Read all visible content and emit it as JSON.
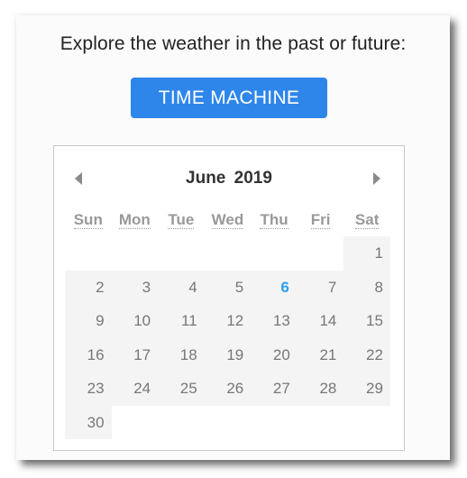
{
  "headline": "Explore the weather in the past or future:",
  "time_machine_button": "TIME MACHINE",
  "calendar": {
    "month": "June",
    "year": "2019",
    "prev_icon": "triangle-left",
    "next_icon": "triangle-right",
    "weekdays": [
      "Sun",
      "Mon",
      "Tue",
      "Wed",
      "Thu",
      "Fri",
      "Sat"
    ],
    "today": "6",
    "accent_color": "#2d9ef0",
    "weeks": [
      [
        "",
        "",
        "",
        "",
        "",
        "",
        "1"
      ],
      [
        "2",
        "3",
        "4",
        "5",
        "6",
        "7",
        "8"
      ],
      [
        "9",
        "10",
        "11",
        "12",
        "13",
        "14",
        "15"
      ],
      [
        "16",
        "17",
        "18",
        "19",
        "20",
        "21",
        "22"
      ],
      [
        "23",
        "24",
        "25",
        "26",
        "27",
        "28",
        "29"
      ],
      [
        "30",
        "",
        "",
        "",
        "",
        "",
        ""
      ]
    ]
  }
}
